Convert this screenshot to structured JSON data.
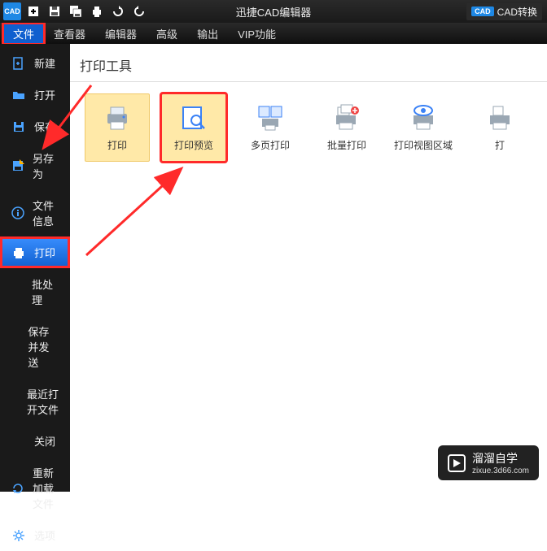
{
  "titlebar": {
    "logo_text": "CAD",
    "app_title": "迅捷CAD编辑器",
    "right_button_pill": "CAD",
    "right_button_label": "CAD转换"
  },
  "menubar": {
    "items": [
      {
        "label": "文件",
        "active": true,
        "highlighted": true
      },
      {
        "label": "查看器"
      },
      {
        "label": "编辑器"
      },
      {
        "label": "高级"
      },
      {
        "label": "输出"
      },
      {
        "label": "VIP功能"
      }
    ]
  },
  "file_menu": {
    "items": [
      {
        "icon": "file-plus",
        "label": "新建"
      },
      {
        "icon": "folder-open",
        "label": "打开"
      },
      {
        "icon": "save",
        "label": "保存"
      },
      {
        "icon": "save-as",
        "label": "另存为"
      },
      {
        "icon": "info",
        "label": "文件信息"
      },
      {
        "icon": "print",
        "label": "打印",
        "selected": true,
        "highlighted": true
      },
      {
        "icon": "batch",
        "label": "批处理"
      },
      {
        "icon": "send",
        "label": "保存并发送"
      },
      {
        "icon": "recent",
        "label": "最近打开文件"
      },
      {
        "icon": "close",
        "label": "关闭"
      },
      {
        "icon": "reload",
        "label": "重新加载文件"
      },
      {
        "icon": "options",
        "label": "选项"
      }
    ]
  },
  "content_panel": {
    "title": "打印工具",
    "tools": [
      {
        "icon": "printer",
        "label": "打印",
        "selected": true
      },
      {
        "icon": "preview",
        "label": "打印预览",
        "selected": true,
        "highlighted": true
      },
      {
        "icon": "multipage",
        "label": "多页打印"
      },
      {
        "icon": "batchprint",
        "label": "批量打印"
      },
      {
        "icon": "viewport",
        "label": "打印视图区域"
      },
      {
        "icon": "previewfile",
        "label": "打"
      }
    ]
  },
  "watermark": {
    "main": "溜溜自学",
    "sub": "zixue.3d66.com"
  }
}
